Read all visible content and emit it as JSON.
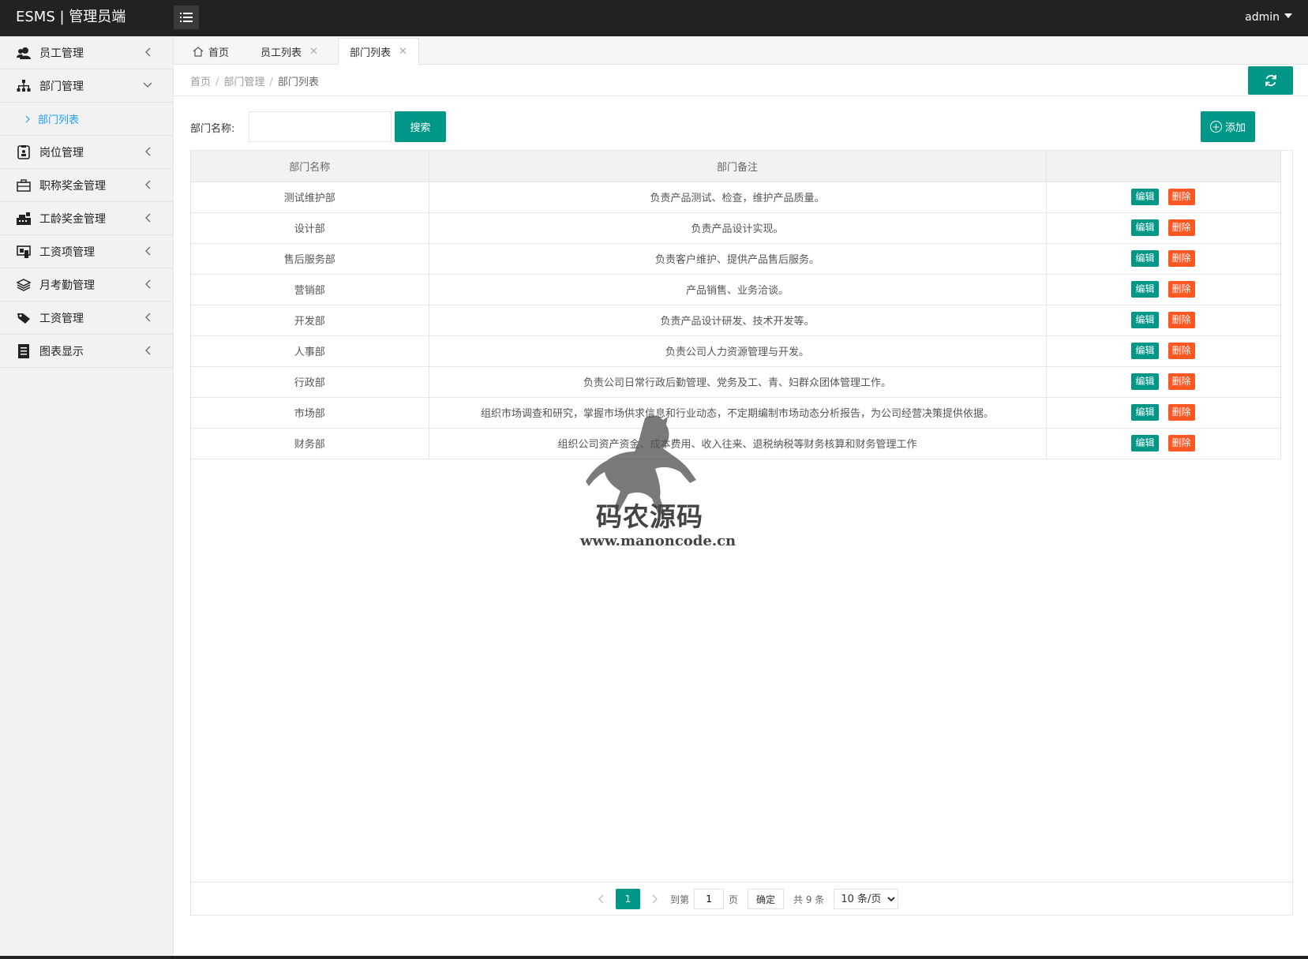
{
  "header": {
    "logo": "ESMS | 管理员端",
    "user": "admin"
  },
  "sidebar": {
    "items": [
      {
        "label": "员工管理",
        "icon": "users-icon"
      },
      {
        "label": "部门管理",
        "icon": "sitemap-icon",
        "expanded": true,
        "children": [
          {
            "label": "部门列表"
          }
        ]
      },
      {
        "label": "岗位管理",
        "icon": "badge-icon"
      },
      {
        "label": "职称奖金管理",
        "icon": "briefcase-icon"
      },
      {
        "label": "工龄奖金管理",
        "icon": "cash-register-icon"
      },
      {
        "label": "工资项管理",
        "icon": "monitor-icon"
      },
      {
        "label": "月考勤管理",
        "icon": "layers-icon"
      },
      {
        "label": "工资管理",
        "icon": "tag-icon"
      },
      {
        "label": "图表显示",
        "icon": "receipt-icon"
      }
    ]
  },
  "tabs": [
    {
      "label": "首页",
      "icon": "home-icon"
    },
    {
      "label": "员工列表",
      "closable": true
    },
    {
      "label": "部门列表",
      "closable": true,
      "active": true
    }
  ],
  "breadcrumb": [
    "首页",
    "部门管理",
    "部门列表"
  ],
  "search": {
    "label": "部门名称:",
    "value": "",
    "button": "搜索"
  },
  "add_button": "添加",
  "table": {
    "headers": [
      "部门名称",
      "部门备注",
      ""
    ],
    "edit_label": "编辑",
    "delete_label": "删除",
    "rows": [
      {
        "name": "测试维护部",
        "note": "负责产品测试、检查，维护产品质量。"
      },
      {
        "name": "设计部",
        "note": "负责产品设计实现。"
      },
      {
        "name": "售后服务部",
        "note": "负责客户维护、提供产品售后服务。"
      },
      {
        "name": "营销部",
        "note": "产品销售、业务洽谈。"
      },
      {
        "name": "开发部",
        "note": "负责产品设计研发、技术开发等。"
      },
      {
        "name": "人事部",
        "note": "负责公司人力资源管理与开发。"
      },
      {
        "name": "行政部",
        "note": "负责公司日常行政后勤管理、党务及工、青、妇群众团体管理工作。"
      },
      {
        "name": "市场部",
        "note": "组织市场调查和研究，掌握市场供求信息和行业动态，不定期编制市场动态分析报告，为公司经营决策提供依据。"
      },
      {
        "name": "财务部",
        "note": "组织公司资产资金、成本费用、收入往来、退税纳税等财务核算和财务管理工作"
      }
    ]
  },
  "pager": {
    "current": "1",
    "goto_label": "到第",
    "goto_value": "1",
    "page_label": "页",
    "confirm": "确定",
    "total": "共 9 条",
    "limit": "10 条/页"
  },
  "watermark": {
    "title": "码农源码",
    "url": "www.manoncode.cn"
  },
  "colors": {
    "primary": "#009688",
    "danger": "#ff5722",
    "link": "#1e9fff",
    "header": "#222222"
  }
}
